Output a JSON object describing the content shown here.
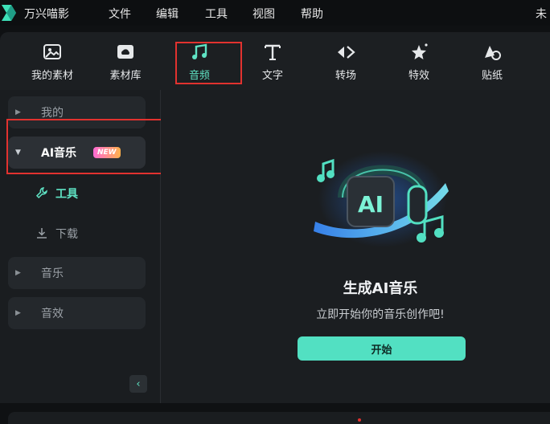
{
  "app": {
    "title": "万兴喵影"
  },
  "menu": {
    "items": [
      "文件",
      "编辑",
      "工具",
      "视图",
      "帮助"
    ],
    "right": "未"
  },
  "toolbar": {
    "items": [
      {
        "label": "我的素材",
        "icon": "image-folder-icon"
      },
      {
        "label": "素材库",
        "icon": "cloud-folder-icon"
      },
      {
        "label": "音频",
        "icon": "music-note-icon",
        "active": true
      },
      {
        "label": "文字",
        "icon": "text-t-icon"
      },
      {
        "label": "转场",
        "icon": "transition-icon"
      },
      {
        "label": "特效",
        "icon": "effects-star-icon"
      },
      {
        "label": "贴纸",
        "icon": "sticker-icon"
      }
    ]
  },
  "sidebar": {
    "my": "我的",
    "ai_music": "AI音乐",
    "ai_badge": "NEW",
    "tools": "工具",
    "download": "下载",
    "music": "音乐",
    "sfx": "音效"
  },
  "main": {
    "title": "生成AI音乐",
    "subtitle": "立即开始你的音乐创作吧!",
    "start": "开始",
    "hero_text": "AI"
  },
  "colors": {
    "accent": "#5fe3c4",
    "button": "#52e0c2",
    "highlight": "#e2322f",
    "badge_start": "#ff6ad5",
    "badge_end": "#ffb14a"
  }
}
